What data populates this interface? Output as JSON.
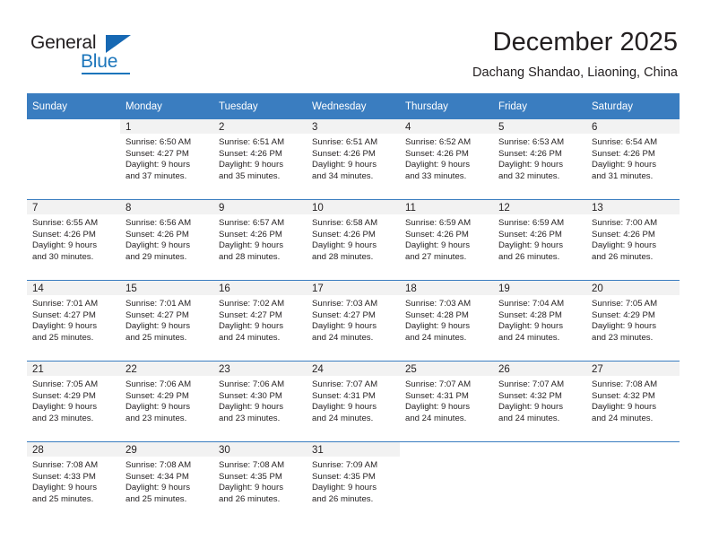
{
  "logo": {
    "word1": "General",
    "word2": "Blue",
    "triangle_color": "#1668b3",
    "blue_color": "#1b75bb"
  },
  "header": {
    "title": "December 2025",
    "subtitle": "Dachang Shandao, Liaoning, China"
  },
  "theme": {
    "header_blue": "#3a7dc0",
    "daynum_band": "#f2f2f2",
    "cell_separator": "#d8d8d8"
  },
  "weekdays": [
    "Sunday",
    "Monday",
    "Tuesday",
    "Wednesday",
    "Thursday",
    "Friday",
    "Saturday"
  ],
  "weeks": [
    [
      {
        "day": "",
        "lines": []
      },
      {
        "day": "1",
        "lines": [
          "Sunrise: 6:50 AM",
          "Sunset: 4:27 PM",
          "Daylight: 9 hours",
          "and 37 minutes."
        ]
      },
      {
        "day": "2",
        "lines": [
          "Sunrise: 6:51 AM",
          "Sunset: 4:26 PM",
          "Daylight: 9 hours",
          "and 35 minutes."
        ]
      },
      {
        "day": "3",
        "lines": [
          "Sunrise: 6:51 AM",
          "Sunset: 4:26 PM",
          "Daylight: 9 hours",
          "and 34 minutes."
        ]
      },
      {
        "day": "4",
        "lines": [
          "Sunrise: 6:52 AM",
          "Sunset: 4:26 PM",
          "Daylight: 9 hours",
          "and 33 minutes."
        ]
      },
      {
        "day": "5",
        "lines": [
          "Sunrise: 6:53 AM",
          "Sunset: 4:26 PM",
          "Daylight: 9 hours",
          "and 32 minutes."
        ]
      },
      {
        "day": "6",
        "lines": [
          "Sunrise: 6:54 AM",
          "Sunset: 4:26 PM",
          "Daylight: 9 hours",
          "and 31 minutes."
        ]
      }
    ],
    [
      {
        "day": "7",
        "lines": [
          "Sunrise: 6:55 AM",
          "Sunset: 4:26 PM",
          "Daylight: 9 hours",
          "and 30 minutes."
        ]
      },
      {
        "day": "8",
        "lines": [
          "Sunrise: 6:56 AM",
          "Sunset: 4:26 PM",
          "Daylight: 9 hours",
          "and 29 minutes."
        ]
      },
      {
        "day": "9",
        "lines": [
          "Sunrise: 6:57 AM",
          "Sunset: 4:26 PM",
          "Daylight: 9 hours",
          "and 28 minutes."
        ]
      },
      {
        "day": "10",
        "lines": [
          "Sunrise: 6:58 AM",
          "Sunset: 4:26 PM",
          "Daylight: 9 hours",
          "and 28 minutes."
        ]
      },
      {
        "day": "11",
        "lines": [
          "Sunrise: 6:59 AM",
          "Sunset: 4:26 PM",
          "Daylight: 9 hours",
          "and 27 minutes."
        ]
      },
      {
        "day": "12",
        "lines": [
          "Sunrise: 6:59 AM",
          "Sunset: 4:26 PM",
          "Daylight: 9 hours",
          "and 26 minutes."
        ]
      },
      {
        "day": "13",
        "lines": [
          "Sunrise: 7:00 AM",
          "Sunset: 4:26 PM",
          "Daylight: 9 hours",
          "and 26 minutes."
        ]
      }
    ],
    [
      {
        "day": "14",
        "lines": [
          "Sunrise: 7:01 AM",
          "Sunset: 4:27 PM",
          "Daylight: 9 hours",
          "and 25 minutes."
        ]
      },
      {
        "day": "15",
        "lines": [
          "Sunrise: 7:01 AM",
          "Sunset: 4:27 PM",
          "Daylight: 9 hours",
          "and 25 minutes."
        ]
      },
      {
        "day": "16",
        "lines": [
          "Sunrise: 7:02 AM",
          "Sunset: 4:27 PM",
          "Daylight: 9 hours",
          "and 24 minutes."
        ]
      },
      {
        "day": "17",
        "lines": [
          "Sunrise: 7:03 AM",
          "Sunset: 4:27 PM",
          "Daylight: 9 hours",
          "and 24 minutes."
        ]
      },
      {
        "day": "18",
        "lines": [
          "Sunrise: 7:03 AM",
          "Sunset: 4:28 PM",
          "Daylight: 9 hours",
          "and 24 minutes."
        ]
      },
      {
        "day": "19",
        "lines": [
          "Sunrise: 7:04 AM",
          "Sunset: 4:28 PM",
          "Daylight: 9 hours",
          "and 24 minutes."
        ]
      },
      {
        "day": "20",
        "lines": [
          "Sunrise: 7:05 AM",
          "Sunset: 4:29 PM",
          "Daylight: 9 hours",
          "and 23 minutes."
        ]
      }
    ],
    [
      {
        "day": "21",
        "lines": [
          "Sunrise: 7:05 AM",
          "Sunset: 4:29 PM",
          "Daylight: 9 hours",
          "and 23 minutes."
        ]
      },
      {
        "day": "22",
        "lines": [
          "Sunrise: 7:06 AM",
          "Sunset: 4:29 PM",
          "Daylight: 9 hours",
          "and 23 minutes."
        ]
      },
      {
        "day": "23",
        "lines": [
          "Sunrise: 7:06 AM",
          "Sunset: 4:30 PM",
          "Daylight: 9 hours",
          "and 23 minutes."
        ]
      },
      {
        "day": "24",
        "lines": [
          "Sunrise: 7:07 AM",
          "Sunset: 4:31 PM",
          "Daylight: 9 hours",
          "and 24 minutes."
        ]
      },
      {
        "day": "25",
        "lines": [
          "Sunrise: 7:07 AM",
          "Sunset: 4:31 PM",
          "Daylight: 9 hours",
          "and 24 minutes."
        ]
      },
      {
        "day": "26",
        "lines": [
          "Sunrise: 7:07 AM",
          "Sunset: 4:32 PM",
          "Daylight: 9 hours",
          "and 24 minutes."
        ]
      },
      {
        "day": "27",
        "lines": [
          "Sunrise: 7:08 AM",
          "Sunset: 4:32 PM",
          "Daylight: 9 hours",
          "and 24 minutes."
        ]
      }
    ],
    [
      {
        "day": "28",
        "lines": [
          "Sunrise: 7:08 AM",
          "Sunset: 4:33 PM",
          "Daylight: 9 hours",
          "and 25 minutes."
        ]
      },
      {
        "day": "29",
        "lines": [
          "Sunrise: 7:08 AM",
          "Sunset: 4:34 PM",
          "Daylight: 9 hours",
          "and 25 minutes."
        ]
      },
      {
        "day": "30",
        "lines": [
          "Sunrise: 7:08 AM",
          "Sunset: 4:35 PM",
          "Daylight: 9 hours",
          "and 26 minutes."
        ]
      },
      {
        "day": "31",
        "lines": [
          "Sunrise: 7:09 AM",
          "Sunset: 4:35 PM",
          "Daylight: 9 hours",
          "and 26 minutes."
        ]
      },
      {
        "day": "",
        "lines": []
      },
      {
        "day": "",
        "lines": []
      },
      {
        "day": "",
        "lines": []
      }
    ]
  ]
}
